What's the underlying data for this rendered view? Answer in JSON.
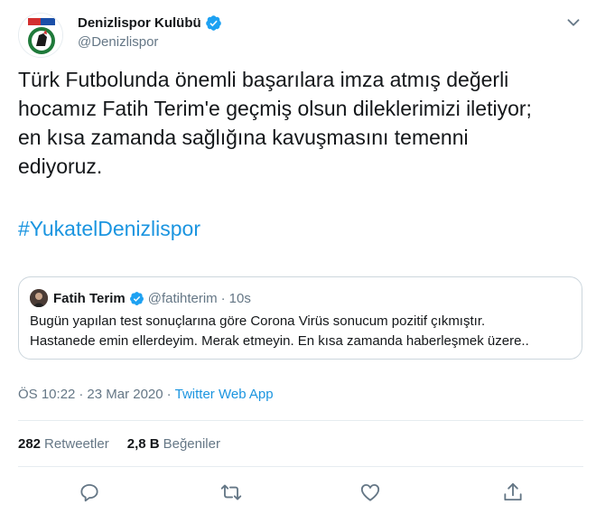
{
  "author": {
    "display_name": "Denizlispor Kulübü",
    "handle": "@Denizlispor",
    "avatar_icon": "denizlispor-crest",
    "verified_icon": "verified-badge-icon"
  },
  "tweet": {
    "lines": [
      "Türk Futbolunda önemli başarılara imza atmış değerli",
      "hocamız Fatih Terim'e geçmiş olsun dileklerimizi iletiyor;",
      "en kısa zamanda sağlığına kavuşmasını temenni",
      "ediyoruz."
    ],
    "hashtag": "#YukatelDenizlispor"
  },
  "quote": {
    "display_name": "Fatih Terim",
    "handle": "@fatihterim",
    "dot": "·",
    "time": "10s",
    "lines": [
      "Bugün yapılan test sonuçlarına göre Corona Virüs sonucum pozitif çıkmıştır.",
      "Hastanede emin ellerdeyim. Merak etmeyin. En kısa zamanda haberleşmek üzere.."
    ]
  },
  "meta": {
    "time": "ÖS 10:22",
    "sep1": "·",
    "date": "23 Mar 2020",
    "sep2": "·",
    "source": "Twitter Web App"
  },
  "stats": {
    "retweets_count": "282",
    "retweets_label": "Retweetler",
    "likes_count": "2,8 B",
    "likes_label": "Beğeniler"
  },
  "actions": [
    "reply-icon",
    "retweet-icon",
    "like-icon",
    "share-icon"
  ],
  "colors": {
    "link": "#1b95e0",
    "secondary_text": "#657786",
    "border": "#ccd6dd",
    "verified": "#1da1f2",
    "brand_green": "#1f7a3a"
  }
}
